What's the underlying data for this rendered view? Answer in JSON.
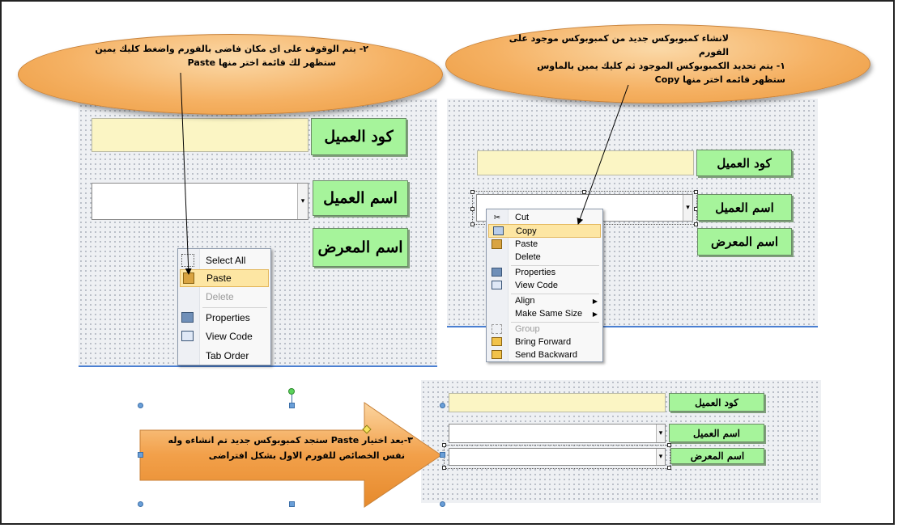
{
  "callout_top_left": {
    "line1": "٢- يتم الوقوف على اى مكان فاضى بالفورم واضغط كليك يمين",
    "line2": "ستظهر لك قائمة اختر منها Paste"
  },
  "callout_top_right": {
    "line1": "لانشاء كمبوبوكس جديد من كمبوبوكس موجود على الفورم",
    "line2": "١- يتم تحديد الكمبوبوكس الموجود ثم كليك يمين بالماوس",
    "line3": "ستظهر قائمه اختر منها Copy"
  },
  "callout_arrow": {
    "line1": "٣-بعد اختيار Paste ستجد كمبوبوكس جديد تم انشاءه وله",
    "line2": "نفس الخصائص للفورم الاول بشكل افتراضى"
  },
  "labels": {
    "customer_code": "كود العميل",
    "customer_name": "اسم العميل",
    "showroom_name": "اسم المعرض"
  },
  "combo_button_glyph": "▾",
  "left_menu": [
    {
      "label": "Select All",
      "icon": "select-all-icon",
      "highlighted": false,
      "disabled": false
    },
    {
      "label": "Paste",
      "icon": "paste-icon",
      "highlighted": true,
      "disabled": false
    },
    {
      "label": "Delete",
      "icon": "",
      "highlighted": false,
      "disabled": true
    },
    {
      "label": "Properties",
      "icon": "properties-icon",
      "highlighted": false,
      "disabled": false
    },
    {
      "label": "View Code",
      "icon": "view-code-icon",
      "highlighted": false,
      "disabled": false
    },
    {
      "label": "Tab Order",
      "icon": "",
      "highlighted": false,
      "disabled": false
    }
  ],
  "right_menu": [
    {
      "label": "Cut",
      "icon": "cut-icon",
      "highlighted": false,
      "disabled": false
    },
    {
      "label": "Copy",
      "icon": "copy-icon",
      "highlighted": true,
      "disabled": false
    },
    {
      "label": "Paste",
      "icon": "paste-icon",
      "highlighted": false,
      "disabled": false
    },
    {
      "label": "Delete",
      "icon": "",
      "highlighted": false,
      "disabled": false
    },
    {
      "label": "Properties",
      "icon": "properties-icon",
      "highlighted": false,
      "disabled": false
    },
    {
      "label": "View Code",
      "icon": "view-code-icon",
      "highlighted": false,
      "disabled": false
    },
    {
      "label": "Align",
      "icon": "",
      "highlighted": false,
      "disabled": false,
      "submenu": true
    },
    {
      "label": "Make Same Size",
      "icon": "",
      "highlighted": false,
      "disabled": false,
      "submenu": true
    },
    {
      "label": "Group",
      "icon": "group-icon",
      "highlighted": false,
      "disabled": true
    },
    {
      "label": "Bring Forward",
      "icon": "bring-forward-icon",
      "highlighted": false,
      "disabled": false
    },
    {
      "label": "Send Backward",
      "icon": "send-backward-icon",
      "highlighted": false,
      "disabled": false
    }
  ],
  "submenu_glyph": "▶",
  "colors": {
    "label_green": "#a6f49b",
    "input_yellow": "#fbf5c4",
    "callout_orange": "#f5b163",
    "menu_highlight": "#fde6a3"
  }
}
